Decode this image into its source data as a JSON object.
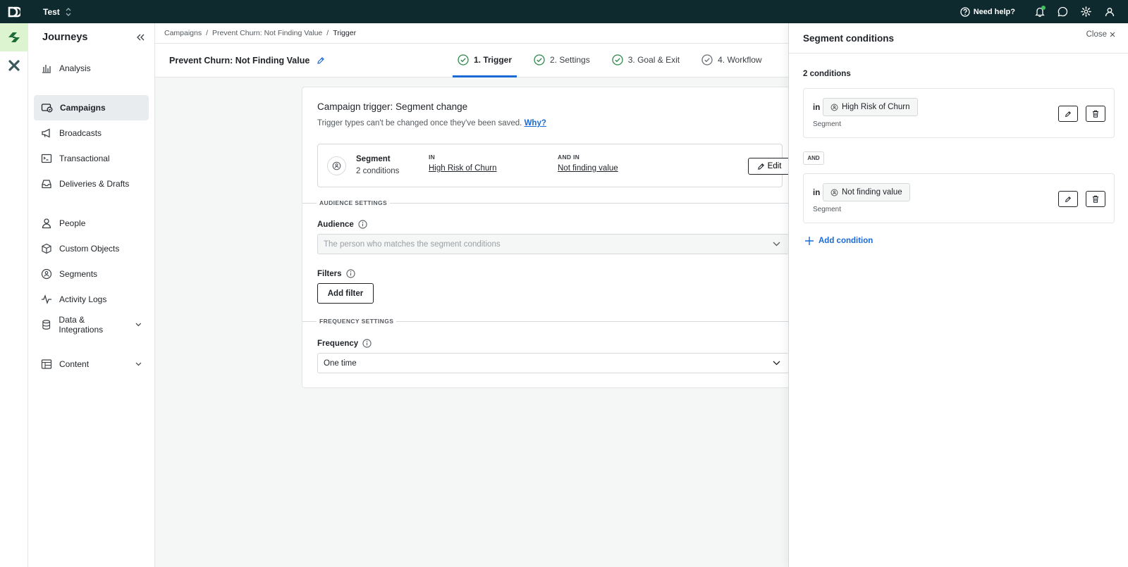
{
  "topbar": {
    "workspace": "Test",
    "help_label": "Need help?"
  },
  "sidebar": {
    "title": "Journeys",
    "items": [
      {
        "label": "Analysis",
        "icon": "bar-chart-icon"
      },
      {
        "label": "Campaigns",
        "icon": "campaigns-icon"
      },
      {
        "label": "Broadcasts",
        "icon": "megaphone-icon"
      },
      {
        "label": "Transactional",
        "icon": "terminal-icon"
      },
      {
        "label": "Deliveries & Drafts",
        "icon": "inbox-icon"
      },
      {
        "label": "People",
        "icon": "person-icon"
      },
      {
        "label": "Custom Objects",
        "icon": "cube-icon"
      },
      {
        "label": "Segments",
        "icon": "segment-icon"
      },
      {
        "label": "Activity Logs",
        "icon": "activity-icon"
      },
      {
        "label": "Data & Integrations",
        "icon": "database-icon"
      },
      {
        "label": "Content",
        "icon": "table-icon"
      }
    ]
  },
  "breadcrumb": {
    "items": [
      "Campaigns",
      "Prevent Churn: Not Finding Value",
      "Trigger"
    ]
  },
  "campaign": {
    "title": "Prevent Churn: Not Finding Value"
  },
  "steps": [
    {
      "label": "1. Trigger"
    },
    {
      "label": "2. Settings"
    },
    {
      "label": "3. Goal & Exit"
    },
    {
      "label": "4. Workflow"
    }
  ],
  "trigger": {
    "heading": "Campaign trigger: Segment change",
    "subtext": "Trigger types can't be changed once they've been saved.",
    "why_link": "Why?",
    "segment_label": "Segment",
    "segment_count": "2 conditions",
    "in_header": "IN",
    "in_value": "High Risk of Churn",
    "and_in_header": "AND IN",
    "and_in_value": "Not finding value",
    "edit_label": "Edit"
  },
  "audience_settings": {
    "section_label": "AUDIENCE SETTINGS",
    "audience_label": "Audience",
    "audience_value": "The person who matches the segment conditions",
    "filters_label": "Filters",
    "add_filter_label": "Add filter"
  },
  "frequency_settings": {
    "section_label": "FREQUENCY SETTINGS",
    "frequency_label": "Frequency",
    "frequency_value": "One time"
  },
  "panel": {
    "title": "Segment conditions",
    "close_label": "Close",
    "count_label": "2 conditions",
    "conditions": [
      {
        "prefix": "in",
        "name": "High Risk of Churn",
        "kind": "Segment"
      },
      {
        "prefix": "in",
        "name": "Not finding value",
        "kind": "Segment"
      }
    ],
    "and_label": "AND",
    "add_condition_label": "Add condition"
  },
  "colors": {
    "topbar_bg": "#0e2a2e",
    "accent_blue": "#1a6ad6",
    "success_green": "#2a8a4a",
    "notification_dot": "#3fbf5e"
  }
}
